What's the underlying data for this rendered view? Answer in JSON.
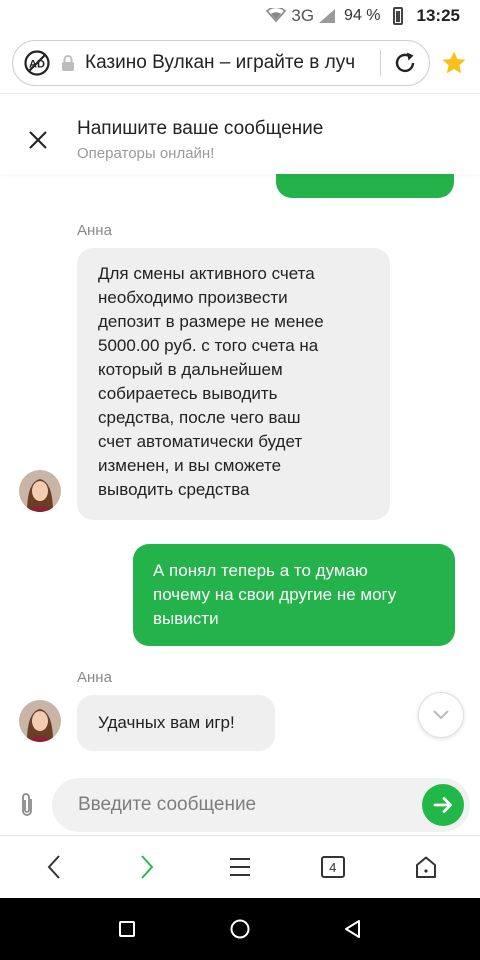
{
  "status_bar": {
    "network": "3G",
    "battery": "94 %",
    "time": "13:25"
  },
  "browser": {
    "url_title": "Казино Вулкан – играйте в луч"
  },
  "chat": {
    "header_title": "Напишите ваше сообщение",
    "header_subtitle": "Операторы онлайн!",
    "messages": [
      {
        "sender": "Анна",
        "text_lines": [
          "Для смены активного счета",
          "необходимо произвести",
          "депозит в размере не менее",
          "5000.00 руб. с того счета на",
          "который в дальнейшем",
          "собираетесь выводить",
          "средства, после чего ваш",
          "счет автоматически будет",
          "изменен, и вы сможете",
          "выводить средства"
        ]
      },
      {
        "sender": "",
        "text_lines": [
          "А понял теперь а то думаю",
          "почему на свои другие не могу",
          "вывисти"
        ]
      },
      {
        "sender": "Анна",
        "text_lines": [
          "Удачных вам игр!"
        ]
      }
    ],
    "input_placeholder": "Введите сообщение"
  },
  "bottom_nav": {
    "tab_count": "4"
  },
  "colors": {
    "accent_green": "#23b34a",
    "agent_bubble": "#efefef",
    "star_yellow": "#f6c21a"
  },
  "icons": [
    "signal-icon",
    "battery-icon",
    "adblock-icon",
    "lock-icon",
    "reload-icon",
    "star-icon",
    "close-icon",
    "chevron-down-icon",
    "paperclip-icon",
    "send-icon",
    "back-icon",
    "forward-icon",
    "menu-icon",
    "tabs-icon",
    "home-icon",
    "recents-icon",
    "home-circle-icon",
    "back-triangle-icon"
  ]
}
